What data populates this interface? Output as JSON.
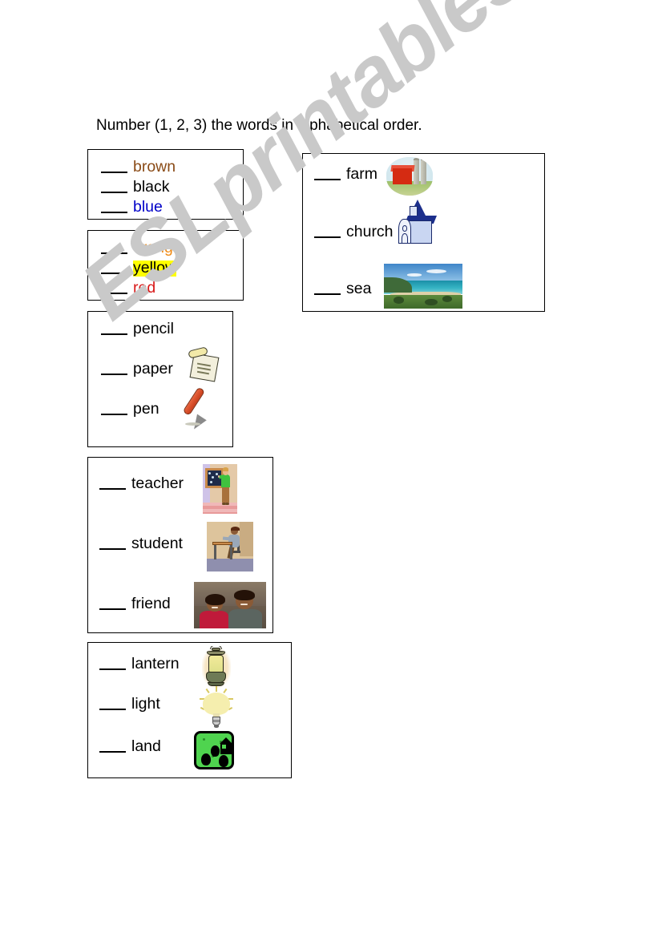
{
  "worksheet": {
    "title": "Number (1, 2, 3) the words in alphabetical order.",
    "watermark": "ESLprintables.com",
    "blank_mark": "___"
  },
  "boxes": [
    {
      "id": "colors-1",
      "name": "colors-box-1",
      "items": [
        {
          "word": "brown",
          "color": "#8a4b17",
          "highlight": null,
          "picture": null
        },
        {
          "word": "black",
          "color": "#000000",
          "highlight": null,
          "picture": null
        },
        {
          "word": "blue",
          "color": "#0000c8",
          "highlight": null,
          "picture": null
        }
      ]
    },
    {
      "id": "colors-2",
      "name": "colors-box-2",
      "items": [
        {
          "word": "orange",
          "color": "#f08a14",
          "highlight": null,
          "picture": null
        },
        {
          "word": "yellow",
          "color": "#000000",
          "highlight": "#ffff00",
          "picture": null
        },
        {
          "word": "red",
          "color": "#d81818",
          "highlight": null,
          "picture": null
        }
      ]
    },
    {
      "id": "stationery",
      "name": "stationery-box",
      "items": [
        {
          "word": "pencil",
          "color": "#000000",
          "highlight": null,
          "picture": null
        },
        {
          "word": "paper",
          "color": "#000000",
          "highlight": null,
          "picture": "scroll-paper-image"
        },
        {
          "word": "pen",
          "color": "#000000",
          "highlight": null,
          "picture": "fountain-pen-image"
        }
      ]
    },
    {
      "id": "people",
      "name": "people-box",
      "items": [
        {
          "word": "teacher",
          "color": "#000000",
          "highlight": null,
          "picture": "teacher-at-blackboard-image"
        },
        {
          "word": "student",
          "color": "#000000",
          "highlight": null,
          "picture": "student-at-desk-image"
        },
        {
          "word": "friend",
          "color": "#000000",
          "highlight": null,
          "picture": "two-children-photo"
        }
      ]
    },
    {
      "id": "l-words",
      "name": "l-words-box",
      "items": [
        {
          "word": "lantern",
          "color": "#000000",
          "highlight": null,
          "picture": "lantern-image"
        },
        {
          "word": "light",
          "color": "#000000",
          "highlight": null,
          "picture": "light-bulb-image"
        },
        {
          "word": "land",
          "color": "#000000",
          "highlight": null,
          "picture": "land-icon-image"
        }
      ]
    },
    {
      "id": "places",
      "name": "places-box",
      "items": [
        {
          "word": "farm",
          "color": "#000000",
          "highlight": null,
          "picture": "farm-barn-image"
        },
        {
          "word": "church",
          "color": "#000000",
          "highlight": null,
          "picture": "church-image"
        },
        {
          "word": "sea",
          "color": "#000000",
          "highlight": null,
          "picture": "sea-coast-photo"
        }
      ]
    }
  ]
}
